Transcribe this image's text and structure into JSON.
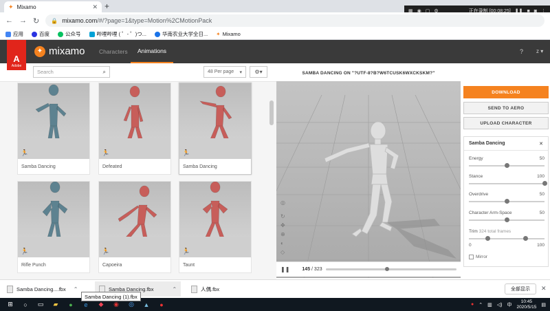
{
  "browser": {
    "tab_title": "Mixamo",
    "url_host": "mixamo.com",
    "url_path": "/#/?page=1&type=Motion%2CMotionPack",
    "bookmarks": [
      "应用",
      "百度",
      "公众号",
      "哔哩哔哩 ( ゜- ゜)つ...",
      "华南农业大学全日...",
      "Mixamo"
    ]
  },
  "recorder": {
    "status": "正在录制 [00:08:25]"
  },
  "overlay_char": "鱼",
  "header": {
    "adobe_label": "Adobe",
    "logo": "mixamo",
    "tabs": {
      "characters": "Characters",
      "animations": "Animations"
    },
    "help": "?",
    "user": "z ▾"
  },
  "toolbar": {
    "search_placeholder": "Search",
    "per_page": "48 Per page"
  },
  "cards": [
    {
      "name": "Samba Dancing",
      "color": "#5d8290"
    },
    {
      "name": "Defeated",
      "color": "#c75e5a"
    },
    {
      "name": "Samba Dancing",
      "color": "#c75e5a"
    },
    {
      "name": "Rifle Punch",
      "color": "#5d8290"
    },
    {
      "name": "Capoeira",
      "color": "#c75e5a"
    },
    {
      "name": "Taunt",
      "color": "#c75e5a"
    }
  ],
  "viewer": {
    "title": "SAMBA DANCING ON \"?UTF-8?B?W6TCUSK6WXCKSKM?\"",
    "frame_current": "145",
    "frame_total": "/ 323",
    "frame_progress": 0.45
  },
  "actions": {
    "download": "DOWNLOAD",
    "send_to_aero": "SEND TO AERO",
    "upload_character": "UPLOAD CHARACTER"
  },
  "settings": {
    "title": "Samba Dancing",
    "sliders": [
      {
        "label": "Energy",
        "value": "50",
        "fraction": 0.5
      },
      {
        "label": "Stance",
        "value": "100",
        "fraction": 1.0
      },
      {
        "label": "Overdrive",
        "value": "50",
        "fraction": 0.5
      },
      {
        "label": "Character Arm-Space",
        "value": "50",
        "fraction": 0.5
      }
    ],
    "trim_label": "Trim",
    "trim_sub": "324 total frames",
    "trim_min": "0",
    "trim_max": "100",
    "trim_start_fraction": 0.25,
    "trim_end_fraction": 0.75,
    "mirror_label": "Mirror"
  },
  "downloads": {
    "items": [
      "Samba Dancing....fbx",
      "Samba Dancing.fbx",
      "人偶.fbx"
    ],
    "show_all": "全部显示",
    "tooltip": "Samba Dancing (1).fbx"
  },
  "taskbar": {
    "time": "10:45",
    "date": "2020/5/15",
    "ime": "中"
  }
}
